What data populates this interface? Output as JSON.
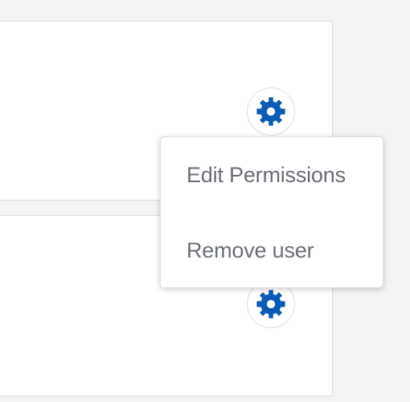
{
  "menu": {
    "items": [
      {
        "label": "Edit Permissions"
      },
      {
        "label": "Remove user"
      }
    ]
  },
  "icons": {
    "gear": "gear-icon"
  },
  "colors": {
    "accent": "#0a5bb5",
    "menu_text": "#6a6e76",
    "background": "#f3f3f3"
  }
}
